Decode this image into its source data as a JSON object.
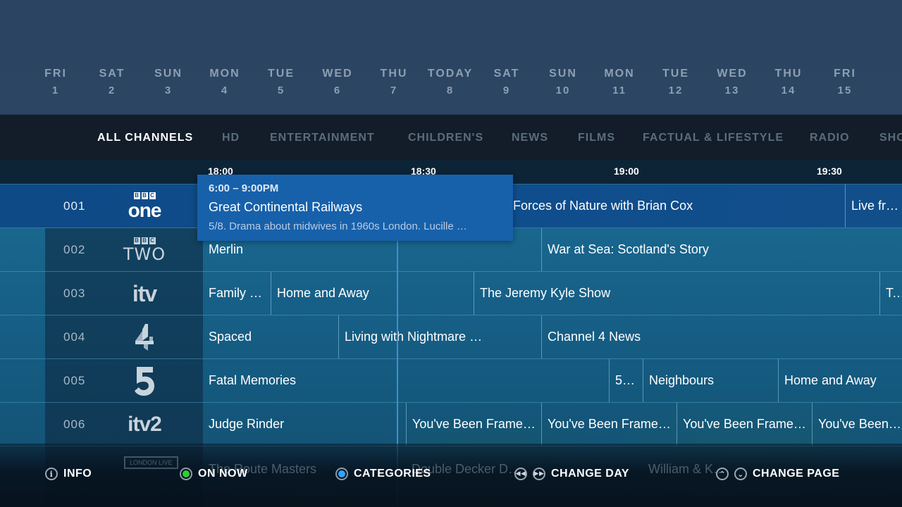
{
  "dates": [
    {
      "name": "FRI",
      "num": "1"
    },
    {
      "name": "SAT",
      "num": "2"
    },
    {
      "name": "SUN",
      "num": "3"
    },
    {
      "name": "MON",
      "num": "4"
    },
    {
      "name": "TUE",
      "num": "5"
    },
    {
      "name": "WED",
      "num": "6"
    },
    {
      "name": "THU",
      "num": "7"
    },
    {
      "name": "TODAY",
      "num": "8"
    },
    {
      "name": "SAT",
      "num": "9"
    },
    {
      "name": "SUN",
      "num": "10"
    },
    {
      "name": "MON",
      "num": "11"
    },
    {
      "name": "TUE",
      "num": "12"
    },
    {
      "name": "WED",
      "num": "13"
    },
    {
      "name": "THU",
      "num": "14"
    },
    {
      "name": "FRI",
      "num": "15"
    }
  ],
  "categories": [
    "ALL CHANNELS",
    "HD",
    "ENTERTAINMENT",
    "CHILDREN'S",
    "NEWS",
    "FILMS",
    "FACTUAL & LIFESTYLE",
    "RADIO",
    "SHO"
  ],
  "times": [
    "18:00",
    "18:30",
    "19:00",
    "19:30"
  ],
  "channels": [
    {
      "num": "001",
      "logo": "bbc-one-logo",
      "programs": [
        "",
        "Forces of Nature with Brian Cox",
        "Live from"
      ]
    },
    {
      "num": "002",
      "logo": "bbc-two-logo",
      "programs": [
        "Merlin",
        "War at Sea: Scotland's Story"
      ]
    },
    {
      "num": "003",
      "logo": "itv-logo",
      "programs": [
        "Family …",
        "Home and Away",
        "The Jeremy Kyle Show",
        "Tak"
      ]
    },
    {
      "num": "004",
      "logo": "channel-4-logo",
      "programs": [
        "Spaced",
        "Living with Nightmare …",
        "Channel 4 News"
      ]
    },
    {
      "num": "005",
      "logo": "channel-5-logo",
      "programs": [
        "Fatal Memories",
        "5…",
        "Neighbours",
        "Home and Away"
      ]
    },
    {
      "num": "006",
      "logo": "itv2-logo",
      "programs": [
        "Judge Rinder",
        "You've Been Frame…",
        "You've Been Frame…",
        "You've Been Frame…",
        "You've Been Fr"
      ]
    }
  ],
  "logos": {
    "bbc_box": "BBC",
    "one": "one",
    "two": "TWO",
    "itv": "itv",
    "itv2": "itv2",
    "london": "LONDON LIVE"
  },
  "faded_row": [
    "The Route Masters",
    "Double Decker D…",
    "…",
    "William & K…"
  ],
  "popup": {
    "time": "6:00 – 9:00PM",
    "title": "Great Continental Railways",
    "desc": "5/8. Drama about midwives in 1960s London. Lucille …"
  },
  "footer": {
    "info": "INFO",
    "on_now": "ON NOW",
    "categories": "CATEGORIES",
    "change_day": "CHANGE DAY",
    "change_page": "CHANGE PAGE"
  },
  "colors": {
    "accent": "#1761ab",
    "green": "#2fcf2f",
    "blue": "#2fa4ff"
  }
}
